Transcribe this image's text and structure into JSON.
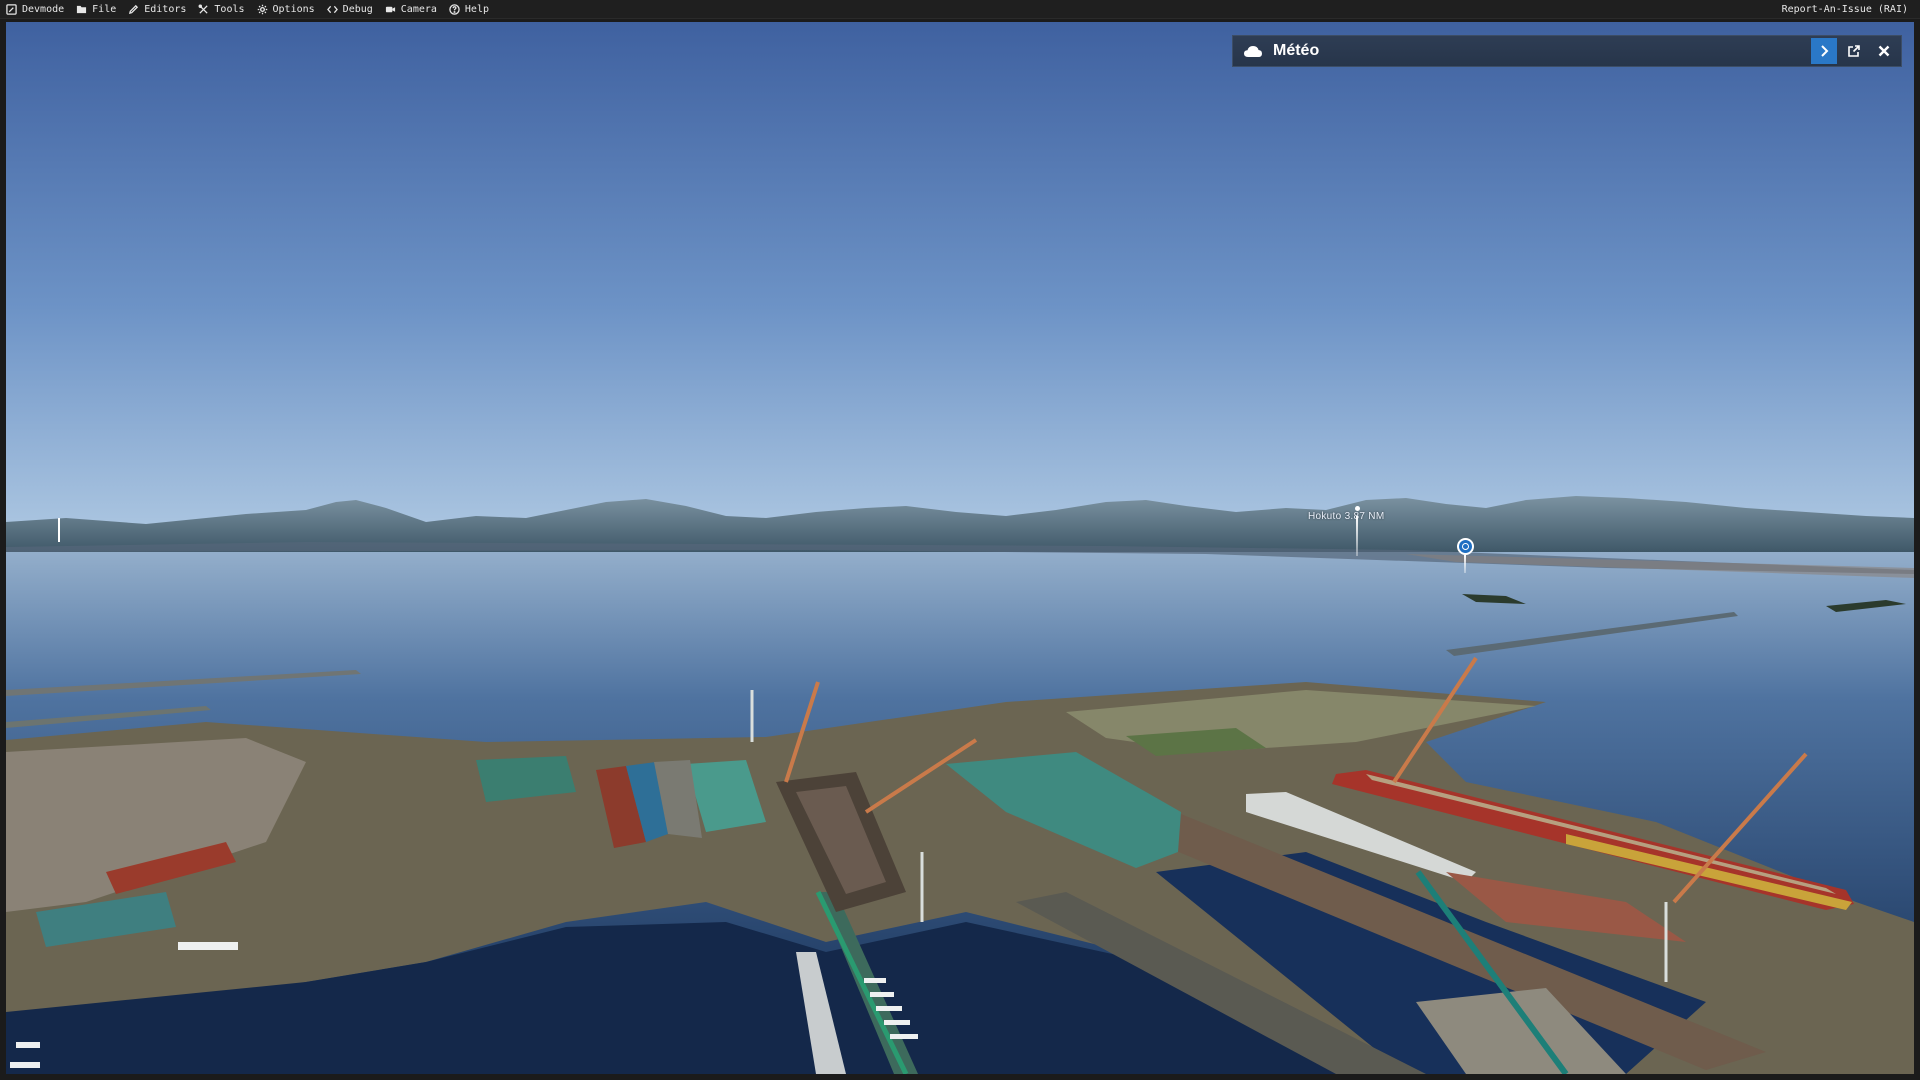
{
  "menubar": {
    "items": [
      {
        "label": "Devmode",
        "icon": "devmode-icon"
      },
      {
        "label": "File",
        "icon": "folder-icon"
      },
      {
        "label": "Editors",
        "icon": "pencil-icon"
      },
      {
        "label": "Tools",
        "icon": "tools-icon"
      },
      {
        "label": "Options",
        "icon": "gear-icon"
      },
      {
        "label": "Debug",
        "icon": "code-icon"
      },
      {
        "label": "Camera",
        "icon": "camera-icon"
      },
      {
        "label": "Help",
        "icon": "help-icon"
      }
    ],
    "report_label": "Report-An-Issue (RAI)"
  },
  "meteo_panel": {
    "title": "Météo",
    "icon": "cloud-icon",
    "buttons": [
      "chevron-right-icon",
      "external-window-icon",
      "close-icon"
    ],
    "accent_color": "#2a78c7"
  },
  "scene": {
    "poi_label": "Hokuto 3.87 NM"
  }
}
